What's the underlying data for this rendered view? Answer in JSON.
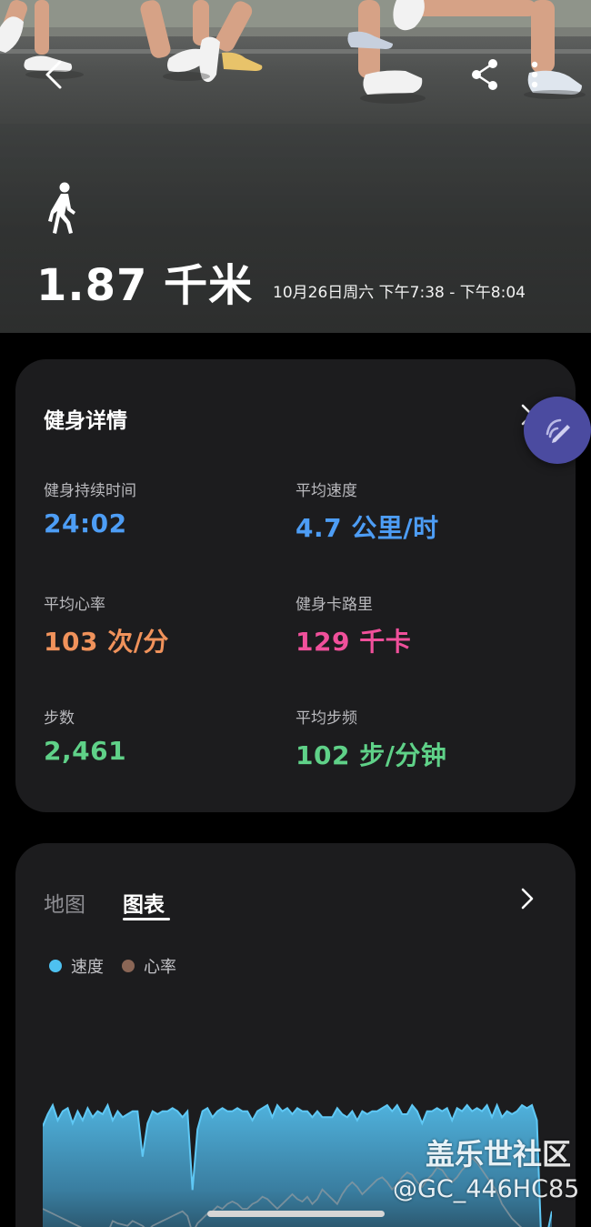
{
  "hero": {
    "activity_icon": "walk-icon",
    "distance": "1.87 千米",
    "time_range": "10月26日周六 下午7:38 - 下午8:04",
    "icons": {
      "back": "back-arrow-icon",
      "share": "share-icon",
      "more": "more-vertical-icon"
    }
  },
  "details": {
    "title": "健身详情",
    "stats": [
      {
        "label": "健身持续时间",
        "value": "24:02",
        "color": "#4d9df5"
      },
      {
        "label": "平均速度",
        "value": "4.7 公里/时",
        "color": "#4d9df5"
      },
      {
        "label": "平均心率",
        "value": "103 次/分",
        "color": "#f0925b"
      },
      {
        "label": "健身卡路里",
        "value": "129 千卡",
        "color": "#f0509b"
      },
      {
        "label": "步数",
        "value": "2,461",
        "color": "#5fd188"
      },
      {
        "label": "平均步频",
        "value": "102 步/分钟",
        "color": "#5fd188"
      }
    ],
    "edit_icon": "edit-pen-icon"
  },
  "chart_panel": {
    "tabs": [
      {
        "label": "地图",
        "active": false
      },
      {
        "label": "图表",
        "active": true
      }
    ],
    "legend": [
      {
        "label": "速度",
        "color": "#4ec1f0"
      },
      {
        "label": "心率",
        "color": "#8a6656"
      }
    ]
  },
  "chart_data": {
    "type": "area",
    "title": "",
    "xlabel": "",
    "ylabel": "",
    "series": [
      {
        "name": "速度",
        "values": [
          4.4,
          4.8,
          5.1,
          4.6,
          4.9,
          5.0,
          4.5,
          4.9,
          4.6,
          5.0,
          4.7,
          4.9,
          4.8,
          5.1,
          4.6,
          4.9,
          4.7,
          4.8,
          4.9,
          4.9,
          3.4,
          4.5,
          4.9,
          4.8,
          4.9,
          4.9,
          5.0,
          4.9,
          4.7,
          4.9,
          2.3,
          4.3,
          4.9,
          5.0,
          4.7,
          4.9,
          5.0,
          4.9,
          4.9,
          5.0,
          4.9,
          4.9,
          4.6,
          4.9,
          5.0,
          5.1,
          4.7,
          5.1,
          4.9,
          5.0,
          4.8,
          5.0,
          4.9,
          4.9,
          4.7,
          4.9,
          4.7,
          4.7,
          4.7,
          5.0,
          4.8,
          4.7,
          4.9,
          4.6,
          4.9,
          4.8,
          4.9,
          4.9,
          5.0,
          5.1,
          4.9,
          5.1,
          4.8,
          4.8,
          5.1,
          4.9,
          4.5,
          4.9,
          4.9,
          5.0,
          4.9,
          5.0,
          4.6,
          5.0,
          4.9,
          5.1,
          4.9,
          5.0,
          4.9,
          5.1,
          4.7,
          5.1,
          4.7,
          4.9,
          4.8,
          4.9,
          5.1,
          5.0,
          5.1,
          4.6,
          0.0,
          0.8,
          1.6
        ]
      },
      {
        "name": "心率",
        "values": [
          92,
          90,
          88,
          86,
          84,
          82,
          80,
          78,
          76,
          74,
          72,
          70,
          70,
          72,
          82,
          80,
          79,
          78,
          82,
          80,
          78,
          74,
          78,
          80,
          82,
          84,
          86,
          88,
          90,
          86,
          72,
          80,
          84,
          88,
          90,
          94,
          92,
          96,
          98,
          96,
          92,
          92,
          96,
          98,
          102,
          100,
          96,
          92,
          96,
          100,
          104,
          100,
          98,
          102,
          96,
          100,
          108,
          104,
          100,
          96,
          104,
          110,
          114,
          110,
          104,
          108,
          112,
          116,
          118,
          114,
          108,
          112,
          118,
          122,
          120,
          114,
          110,
          116,
          120,
          126,
          124,
          118,
          114,
          118,
          124,
          128,
          134,
          130,
          124,
          118,
          112,
          106,
          96,
          90,
          84,
          80,
          76,
          72,
          66
        ]
      }
    ],
    "ylim": [
      0,
      6
    ],
    "grid": false,
    "legend_position": "top-left"
  },
  "watermark": {
    "site": "盖乐世社区",
    "user": "@GC_446HC85"
  }
}
